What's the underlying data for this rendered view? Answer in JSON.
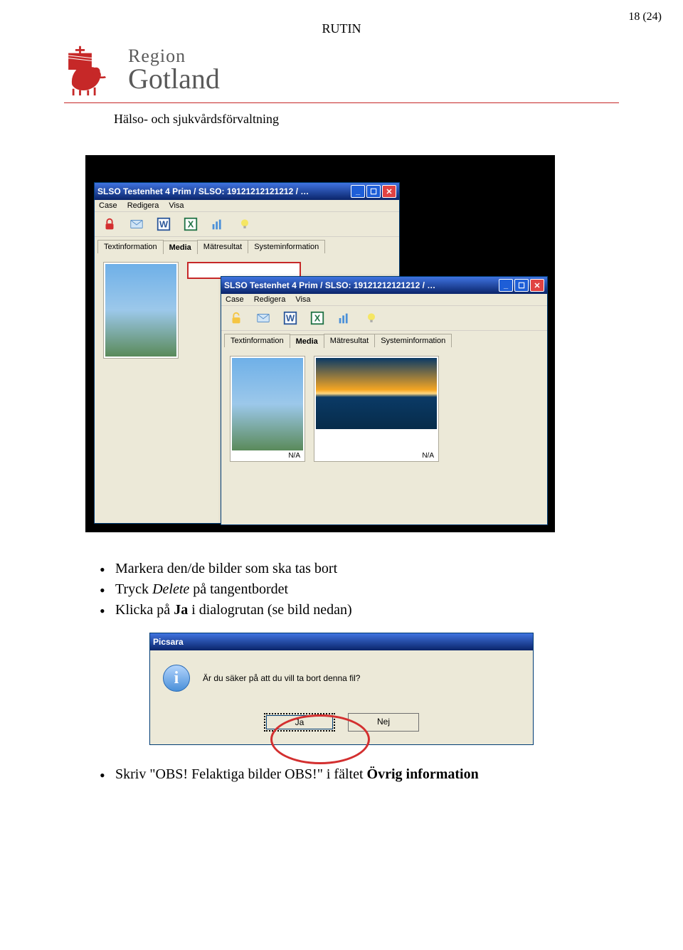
{
  "page_number": "18 (24)",
  "header_label": "RUTIN",
  "logo": {
    "region": "Region",
    "gotland": "Gotland"
  },
  "department": "Hälso- och sjukvårdsförvaltning",
  "win": {
    "title": "SLSO Testenhet 4 Prim / SLSO: 19121212121212 / …",
    "min_glyph": "_",
    "max_glyph": "☐",
    "close_glyph": "✕",
    "menu": {
      "case": "Case",
      "redigera": "Redigera",
      "visa": "Visa"
    },
    "tabs": {
      "text": "Textinformation",
      "media": "Media",
      "matresultat": "Mätresultat",
      "system": "Systeminformation"
    },
    "na": "N/A"
  },
  "bullets": {
    "b1_pre": "Markera den/de bilder som ska tas bort",
    "b2_pre": "Tryck ",
    "b2_em": "Delete",
    "b2_post": " på tangentbordet",
    "b3_pre": "Klicka på ",
    "b3_strong": "Ja",
    "b3_post": " i dialogrutan (se bild nedan)"
  },
  "dialog": {
    "title": "Picsara",
    "msg": "Är du säker på att du vill ta bort denna fil?",
    "ja": "Ja",
    "nej": "Nej"
  },
  "bullet4": {
    "pre": "Skriv \"OBS! Felaktiga bilder OBS!\" i fältet ",
    "strong": "Övrig information"
  }
}
